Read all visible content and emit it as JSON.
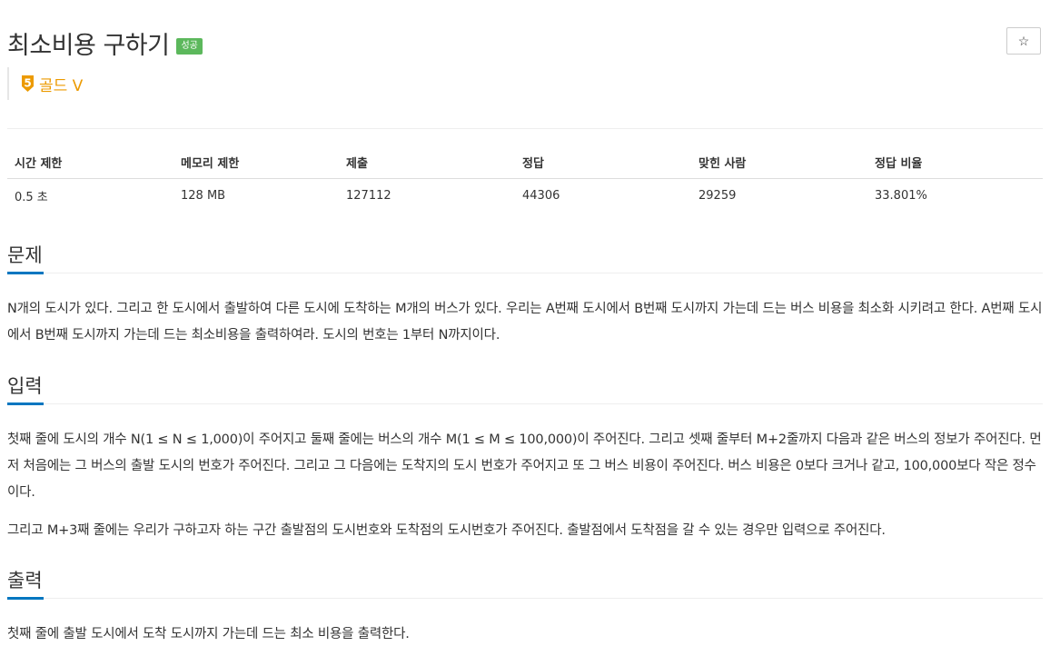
{
  "problem": {
    "title": "최소비용 구하기",
    "status_badge": "성공",
    "star_icon": "☆",
    "tier": {
      "number": "5",
      "label": "골드 V",
      "color": "#ec9a00"
    }
  },
  "stats": {
    "headers": [
      "시간 제한",
      "메모리 제한",
      "제출",
      "정답",
      "맞힌 사람",
      "정답 비율"
    ],
    "values": [
      "0.5 초",
      "128 MB",
      "127112",
      "44306",
      "29259",
      "33.801%"
    ]
  },
  "sections": {
    "problem": {
      "heading": "문제",
      "paragraphs": [
        "N개의 도시가 있다. 그리고 한 도시에서 출발하여 다른 도시에 도착하는 M개의 버스가 있다. 우리는 A번째 도시에서 B번째 도시까지 가는데 드는 버스 비용을 최소화 시키려고 한다. A번째 도시에서 B번째 도시까지 가는데 드는 최소비용을 출력하여라. 도시의 번호는 1부터 N까지이다."
      ]
    },
    "input": {
      "heading": "입력",
      "paragraphs": [
        "첫째 줄에 도시의 개수 N(1 ≤ N ≤ 1,000)이 주어지고 둘째 줄에는 버스의 개수 M(1 ≤ M ≤ 100,000)이 주어진다. 그리고 셋째 줄부터 M+2줄까지 다음과 같은 버스의 정보가 주어진다. 먼저 처음에는 그 버스의 출발 도시의 번호가 주어진다. 그리고 그 다음에는 도착지의 도시 번호가 주어지고 또 그 버스 비용이 주어진다. 버스 비용은 0보다 크거나 같고, 100,000보다 작은 정수이다.",
        "그리고 M+3째 줄에는 우리가 구하고자 하는 구간 출발점의 도시번호와 도착점의 도시번호가 주어진다. 출발점에서 도착점을 갈 수 있는 경우만 입력으로 주어진다."
      ]
    },
    "output": {
      "heading": "출력",
      "paragraphs": [
        "첫째 줄에 출발 도시에서 도착 도시까지 가는데 드는 최소 비용을 출력한다."
      ]
    }
  },
  "colors": {
    "accent": "#0076c0",
    "success": "#5cb85c"
  }
}
